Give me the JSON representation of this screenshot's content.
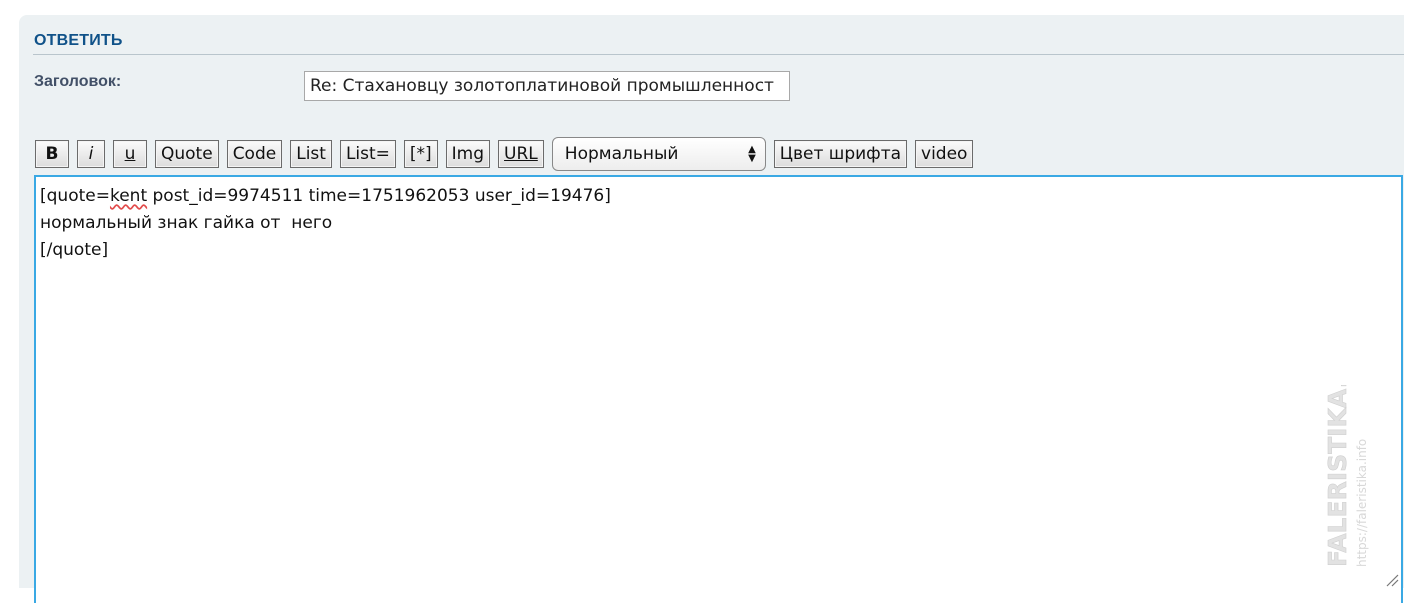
{
  "reply_panel": {
    "title": "ОТВЕТИТЬ",
    "subject_label": "Заголовок:",
    "subject_value": "Re: Стахановцу золотоплатиновой промышленност"
  },
  "toolbar": {
    "bold": "B",
    "italic": "i",
    "underline": "u",
    "quote": "Quote",
    "code": "Code",
    "list": "List",
    "list_numbered": "List=",
    "list_item": "[*]",
    "img": "Img",
    "url": "URL",
    "font_size_selected": "Нормальный",
    "font_color": "Цвет шрифта",
    "video": "video"
  },
  "editor": {
    "line1_prefix": "[quote=",
    "line1_user": "kent",
    "line1_suffix": " post_id=9974511 time=1751962053 user_id=19476]",
    "line2": "нормальный знак гайка от  него",
    "line3": "[/quote]"
  },
  "watermark": {
    "main": "FALERISTIKA.INFO",
    "url": "https://faleristika.info"
  },
  "colors": {
    "panel_bg": "#ecf1f3",
    "title": "#105289",
    "label": "#425067",
    "editor_focus_border": "#3aa9e4"
  },
  "icons": {
    "select_arrow": "up-down-arrows-icon",
    "resize": "resize-grip-icon"
  }
}
